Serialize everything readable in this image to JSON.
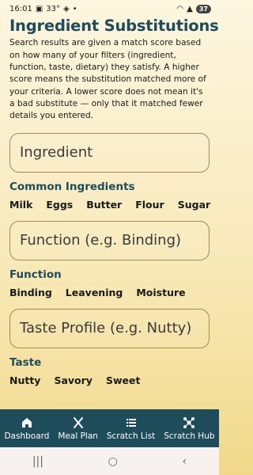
{
  "status": {
    "time": "16:01",
    "temp": "33°",
    "battery": "37"
  },
  "page": {
    "title": "Ingredient Substitutions",
    "description": "Search results are given a match score based on how many of your filters (ingredient, function, taste, dietary) they satisfy. A higher score means the substitution matched more of your criteria. A lower score does not mean it's a bad substitute — only that it matched fewer details you entered."
  },
  "ingredient": {
    "placeholder": "Ingredient",
    "heading": "Common Ingredients",
    "chips": [
      "Milk",
      "Eggs",
      "Butter",
      "Flour",
      "Sugar"
    ]
  },
  "function": {
    "placeholder": "Function (e.g. Binding)",
    "heading": "Function",
    "chips": [
      "Binding",
      "Leavening",
      "Moisture"
    ]
  },
  "taste": {
    "placeholder": "Taste Profile (e.g. Nutty)",
    "heading": "Taste",
    "chips": [
      "Nutty",
      "Savory",
      "Sweet"
    ]
  },
  "nav": {
    "items": [
      {
        "label": "Dashboard",
        "icon": "home-icon"
      },
      {
        "label": "Meal Plan",
        "icon": "utensils-icon"
      },
      {
        "label": "Scratch List",
        "icon": "list-icon"
      },
      {
        "label": "Scratch Hub",
        "icon": "hub-icon"
      }
    ]
  },
  "colors": {
    "accent": "#1f4c5b",
    "background_top": "#fdf6e0",
    "background_bottom": "#f1d989"
  }
}
